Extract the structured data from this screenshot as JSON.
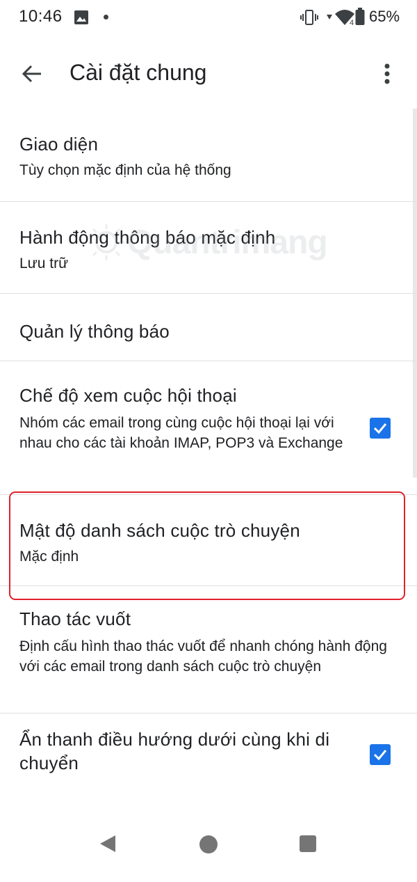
{
  "status_bar": {
    "time": "10:46",
    "battery_percent": "65%",
    "signal_badge": "4"
  },
  "app_bar": {
    "title": "Cài đặt chung",
    "back_icon": "arrow-back-icon",
    "overflow_icon": "more-vert-icon"
  },
  "settings": [
    {
      "title": "Giao diện",
      "summary": "Tùy chọn mặc định của hệ thống"
    },
    {
      "title": "Hành động thông báo mặc định",
      "summary": "Lưu trữ"
    },
    {
      "title": "Quản lý thông báo"
    },
    {
      "title": "Chế độ xem cuộc hội thoại",
      "summary": "Nhóm các email trong cùng cuộc hội thoại lại với nhau cho các tài khoản IMAP, POP3 và Exchange",
      "checked": true
    },
    {
      "title": "Mật độ danh sách cuộc trò chuyện",
      "summary": "Mặc định"
    },
    {
      "title": "Thao tác vuốt",
      "summary": "Định cấu hình thao thác vuốt để nhanh chóng hành động với các email trong danh sách cuộc trò chuyện",
      "highlighted": true
    },
    {
      "title": "Ẩn thanh điều hướng dưới cùng khi di chuyển",
      "checked": true
    }
  ],
  "watermark": {
    "text": "Quantrimang"
  },
  "colors": {
    "accent": "#1a73e8",
    "highlight": "#e0202a",
    "divider": "#e0e0e0",
    "text": "#202124"
  }
}
